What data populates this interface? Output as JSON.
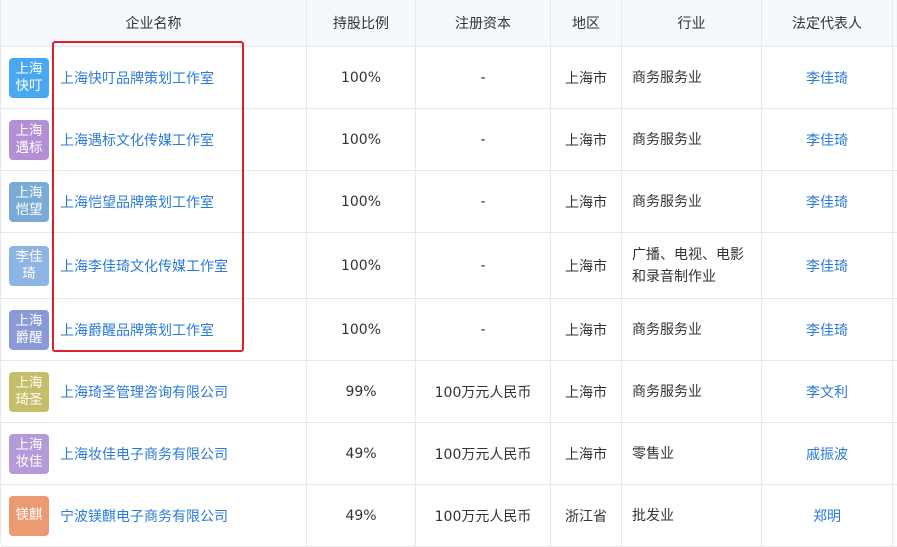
{
  "header": {
    "name": "企业名称",
    "percent": "持股比例",
    "capital": "注册资本",
    "region": "地区",
    "industry": "行业",
    "legal_rep": "法定代表人"
  },
  "rows": [
    {
      "logo_text": "上海快叮",
      "logo_color": "#4aa8f0",
      "name": "上海快叮品牌策划工作室",
      "percent": "100%",
      "capital": "-",
      "region": "上海市",
      "industry": "商务服务业",
      "legal_rep": "李佳琦"
    },
    {
      "logo_text": "上海遇标",
      "logo_color": "#b58fd6",
      "name": "上海遇标文化传媒工作室",
      "percent": "100%",
      "capital": "-",
      "region": "上海市",
      "industry": "商务服务业",
      "legal_rep": "李佳琦"
    },
    {
      "logo_text": "上海恺望",
      "logo_color": "#7aabd6",
      "name": "上海恺望品牌策划工作室",
      "percent": "100%",
      "capital": "-",
      "region": "上海市",
      "industry": "商务服务业",
      "legal_rep": "李佳琦"
    },
    {
      "logo_text": "李佳琦",
      "logo_color": "#8db4e3",
      "name": "上海李佳琦文化传媒工作室",
      "percent": "100%",
      "capital": "-",
      "region": "上海市",
      "industry": "广播、电视、电影和录音制作业",
      "legal_rep": "李佳琦"
    },
    {
      "logo_text": "上海爵醒",
      "logo_color": "#8a9ad8",
      "name": "上海爵醒品牌策划工作室",
      "percent": "100%",
      "capital": "-",
      "region": "上海市",
      "industry": "商务服务业",
      "legal_rep": "李佳琦"
    },
    {
      "logo_text": "上海琦圣",
      "logo_color": "#c4bd6a",
      "name": "上海琦圣管理咨询有限公司",
      "percent": "99%",
      "capital": "100万元人民币",
      "region": "上海市",
      "industry": "商务服务业",
      "legal_rep": "李文利"
    },
    {
      "logo_text": "上海妆佳",
      "logo_color": "#b49ad6",
      "name": "上海妆佳电子商务有限公司",
      "percent": "49%",
      "capital": "100万元人民币",
      "region": "上海市",
      "industry": "零售业",
      "legal_rep": "戚振波"
    },
    {
      "logo_text": "镁麒",
      "logo_color": "#eb9a72",
      "name": "宁波镁麒电子商务有限公司",
      "percent": "49%",
      "capital": "100万元人民币",
      "region": "浙江省",
      "industry": "批发业",
      "legal_rep": "郑明"
    }
  ]
}
